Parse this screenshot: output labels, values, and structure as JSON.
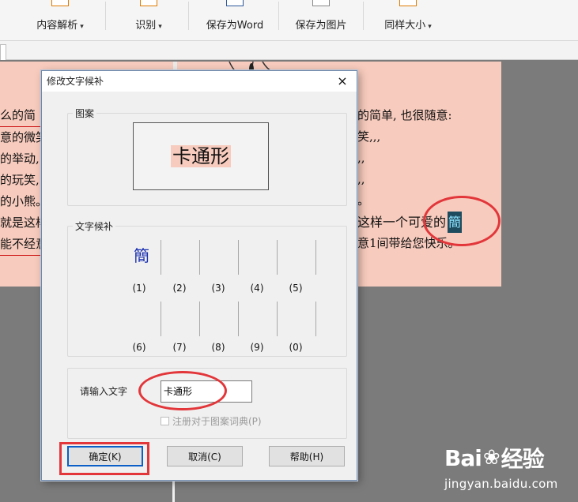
{
  "ribbon": {
    "buttons": [
      {
        "label": "内容解析",
        "has_dropdown": true
      },
      {
        "label": "识别",
        "has_dropdown": true
      },
      {
        "label": "保存为Word",
        "has_dropdown": false
      },
      {
        "label": "保存为图片",
        "has_dropdown": false
      },
      {
        "label": "同样大小",
        "has_dropdown": true
      }
    ],
    "caret": "▾"
  },
  "document": {
    "left_lines": [
      "么的简",
      "意的微笑",
      "的举动,",
      "的玩笑,",
      "的小熊。",
      "就是这样",
      "能不经意"
    ],
    "right_lines": [
      "的简单, 也很随意:",
      "笑,,,",
      ",,",
      ",,",
      "。",
      "这样一个可爱的",
      "意1间带给您快乐。"
    ],
    "special_char": "簡"
  },
  "dialog": {
    "title": "修改文字候补",
    "close": "×",
    "pattern_group_label": "图案",
    "pattern_text": "卡通形",
    "candidates_group_label": "文字候补",
    "candidates": [
      {
        "glyph": "簡",
        "label": "(1)"
      },
      {
        "glyph": "",
        "label": "(2)"
      },
      {
        "glyph": "",
        "label": "(3)"
      },
      {
        "glyph": "",
        "label": "(4)"
      },
      {
        "glyph": "",
        "label": "(5)"
      },
      {
        "glyph": "",
        "label": "(6)"
      },
      {
        "glyph": "",
        "label": "(7)"
      },
      {
        "glyph": "",
        "label": "(8)"
      },
      {
        "glyph": "",
        "label": "(9)"
      },
      {
        "glyph": "",
        "label": "(0)"
      }
    ],
    "input_label": "请输入文字",
    "input_value": "卡通形",
    "checkbox_label": "注册对于图案词典(P)",
    "checkbox_checked": false,
    "buttons": {
      "ok": "确定(K)",
      "cancel": "取消(C)",
      "help": "帮助(H)"
    }
  },
  "watermark": {
    "logo_left": "Bai",
    "logo_right": "经验",
    "url": "jingyan.baidu.com"
  },
  "colors": {
    "page": "#f7cbbd",
    "annotation": "#e2363a",
    "workspace": "#7b7b7b"
  }
}
